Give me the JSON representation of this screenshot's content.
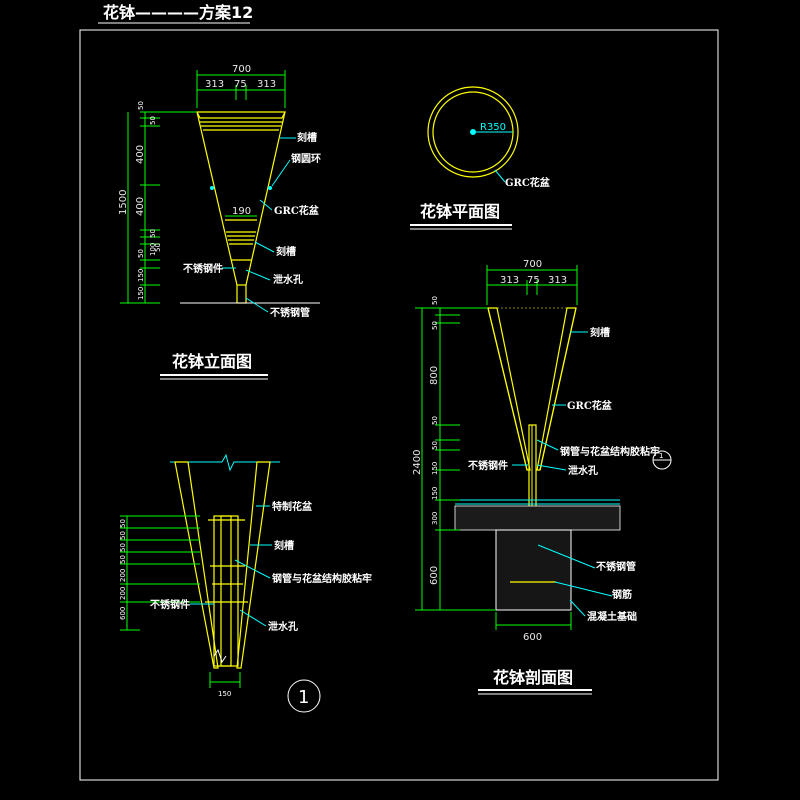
{
  "title": "花钵————方案12",
  "elevation": {
    "label": "花钵立面图",
    "top_width": "700",
    "top_parts": [
      "313",
      "75",
      "313"
    ],
    "inner_width": "190",
    "height_total": "1500",
    "heights": [
      "50",
      "50",
      "400",
      "400",
      "50",
      "50",
      "100",
      "50",
      "150",
      "150"
    ],
    "notes": {
      "groove": "刻槽",
      "steel_ring": "钢圆环",
      "grc": "GRC花盆",
      "groove2": "刻槽",
      "stainless_part": "不锈钢件",
      "drain": "泄水孔",
      "stainless_pipe": "不锈钢管"
    }
  },
  "plan": {
    "label": "花钵平面图",
    "radius": "R350",
    "note": "GRC花盆"
  },
  "section": {
    "label": "花钵剖面图",
    "top_width": "700",
    "top_parts": [
      "313",
      "75",
      "313"
    ],
    "height_total": "2400",
    "heights": [
      "50",
      "50",
      "800",
      "50",
      "50",
      "150",
      "150",
      "300",
      "600"
    ],
    "base_width": "600",
    "detail_marker": "1",
    "notes": {
      "groove": "刻槽",
      "grc": "GRC花盆",
      "fix": "钢管与花盆结构胶粘牢",
      "stainless_part": "不锈钢件",
      "drain": "泄水孔",
      "stainless_pipe": "不锈钢管",
      "steel_pipe": "钢筋",
      "concrete": "混凝土基础"
    }
  },
  "detail": {
    "marker": "1",
    "bottom_width": "150",
    "heights": [
      "50",
      "50",
      "50",
      "50",
      "200",
      "200",
      "600"
    ],
    "notes": {
      "grc": "特制花盆",
      "groove": "刻槽",
      "fix": "钢管与花盆结构胶粘牢",
      "stainless_part": "不锈钢件",
      "drain": "泄水孔"
    }
  }
}
